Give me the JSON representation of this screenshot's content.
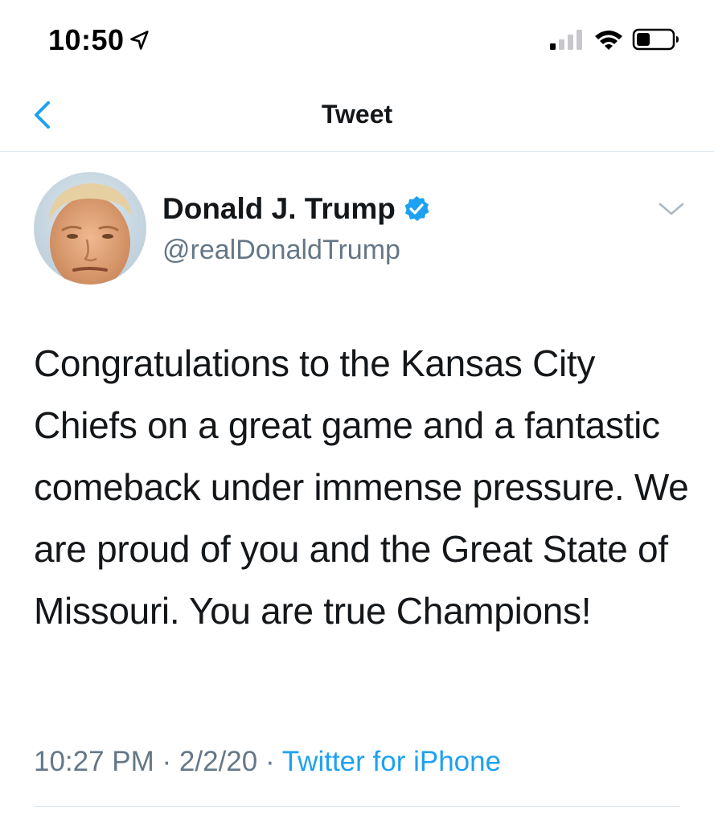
{
  "status_bar": {
    "time": "10:50",
    "location_icon": "location-arrow-icon",
    "signal_icon": "cellular-signal-icon",
    "wifi_icon": "wifi-icon",
    "battery_icon": "battery-icon"
  },
  "header": {
    "back_icon": "chevron-left-icon",
    "title": "Tweet"
  },
  "tweet": {
    "author_name": "Donald J. Trump",
    "verified": true,
    "handle": "@realDonaldTrump",
    "text": "Congratulations to the Kansas City Chiefs on a great game and a fantastic comeback under immense pressure. We are proud of you and the Great State of Missouri. You are true Champions!",
    "time": "10:27 PM",
    "separator": " · ",
    "date": "2/2/20",
    "source": "Twitter for iPhone"
  },
  "colors": {
    "accent": "#1da1f2",
    "secondary_text": "#657786",
    "primary_text": "#14171a",
    "divider": "#e1e8ed"
  }
}
